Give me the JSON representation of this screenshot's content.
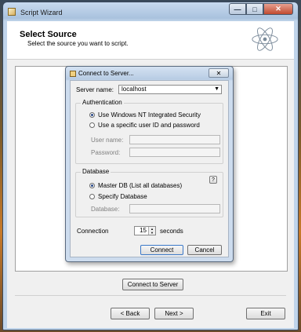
{
  "window": {
    "title": "Script Wizard",
    "controls": {
      "minimize": "—",
      "maximize": "□",
      "close": "✕"
    }
  },
  "header": {
    "title": "Select Source",
    "subtitle": "Select the source you want to script.",
    "logo_icon": "atom-icon"
  },
  "dialog": {
    "title": "Connect to Server...",
    "close": "✕",
    "server_name_label": "Server name:",
    "server_name_value": "localhost",
    "authentication": {
      "group_label": "Authentication",
      "options": [
        "Use Windows NT Integrated Security",
        "Use a specific user ID and password"
      ],
      "selected": 0,
      "user_name_label": "User name:",
      "password_label": "Password:"
    },
    "database": {
      "group_label": "Database",
      "options": [
        "Master DB (List all databases)",
        "Specify Database"
      ],
      "selected": 0,
      "database_label": "Database:",
      "help": "?"
    },
    "connection_label": "Connection",
    "connection_value": "15",
    "connection_unit": "seconds",
    "connect_button": "Connect",
    "cancel_button": "Cancel"
  },
  "page": {
    "connect_to_server_button": "Connect to Server"
  },
  "footer": {
    "back_button": "< Back",
    "next_button": "Next >",
    "exit_button": "Exit"
  }
}
